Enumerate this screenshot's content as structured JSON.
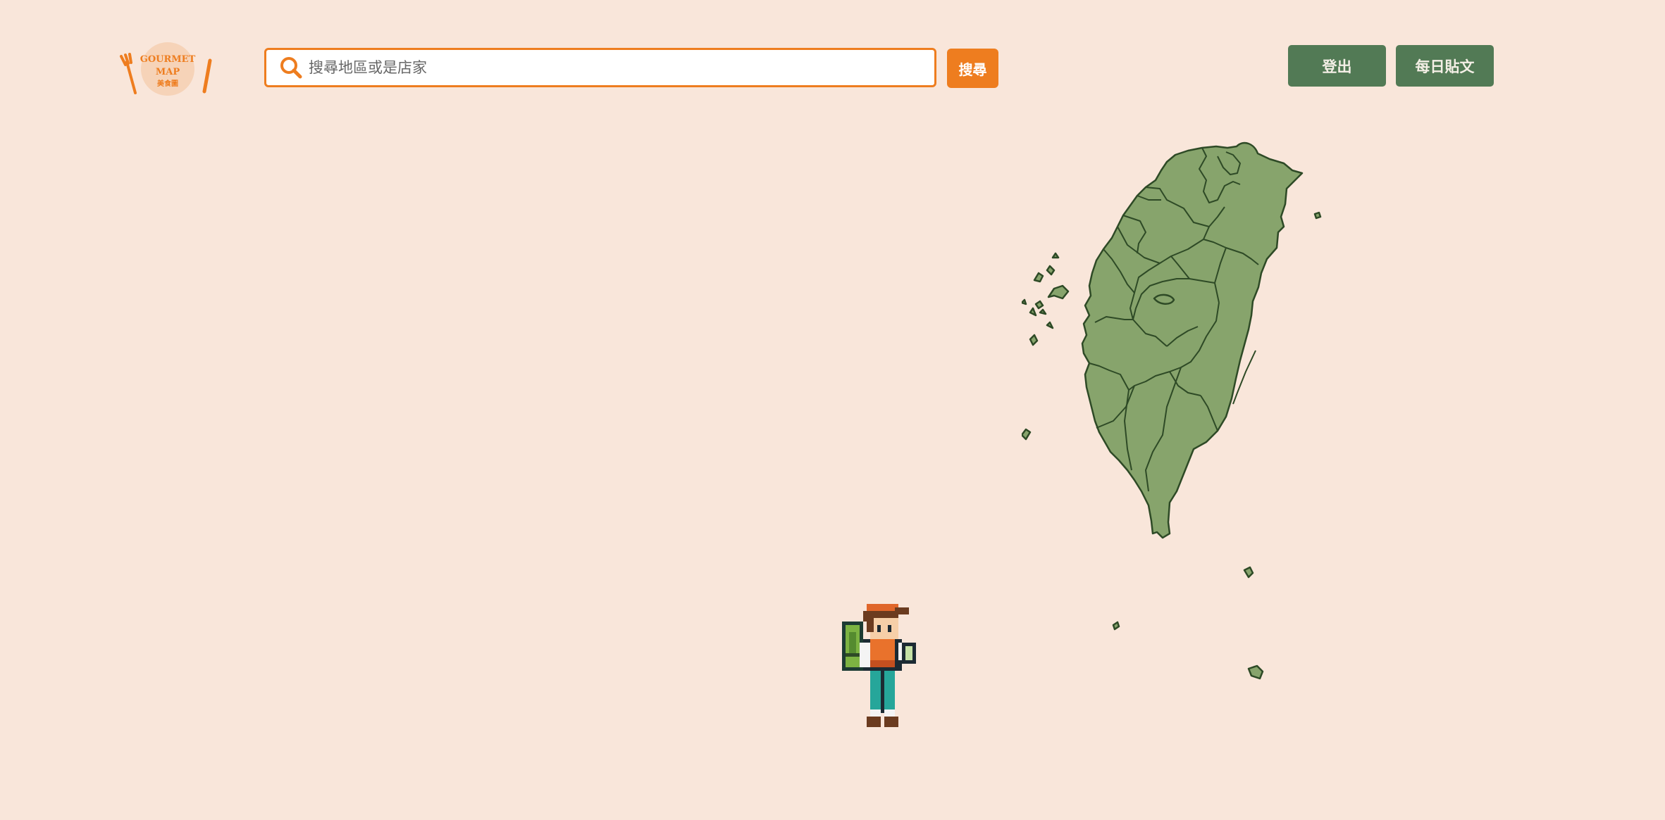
{
  "header": {
    "logo": {
      "text_line1": "GOURMET",
      "text_line2": "MAP",
      "text_line3": "美食圖",
      "color": "#ee7d1f"
    },
    "search": {
      "placeholder": "搜尋地區或是店家",
      "value": "",
      "button_label": "搜尋",
      "icon": "search-icon"
    },
    "nav": {
      "logout_label": "登出",
      "daily_post_label": "每日貼文"
    }
  },
  "main": {
    "map": {
      "region": "Taiwan",
      "fill": "#87a46c",
      "stroke": "#2e4a26"
    },
    "character": {
      "icon": "backpacker-character"
    }
  },
  "colors": {
    "background": "#f9e6da",
    "accent": "#ee7d1f",
    "nav_button": "#527a55"
  }
}
